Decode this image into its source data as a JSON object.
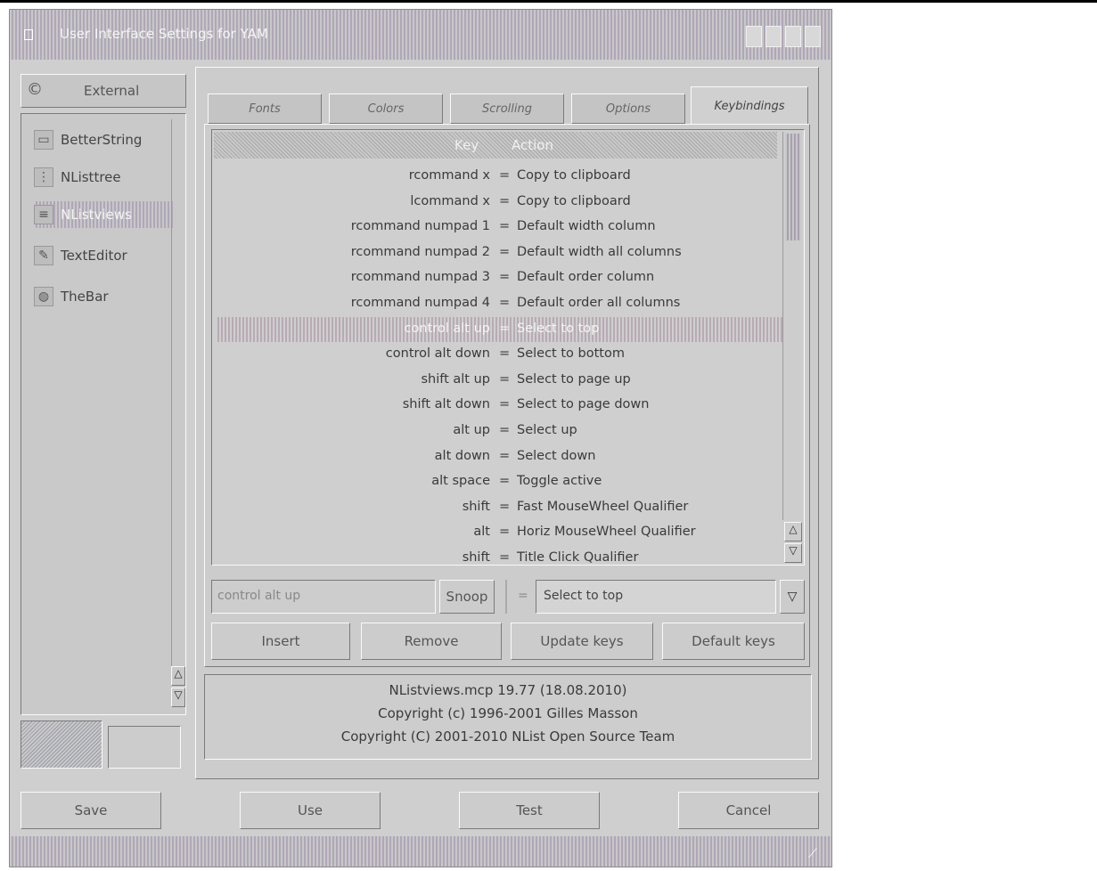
{
  "window": {
    "title": "User Interface Settings for YAM"
  },
  "sidebar": {
    "header_label": "External",
    "items": [
      {
        "label": "BetterString",
        "icon": "string-icon"
      },
      {
        "label": "NListtree",
        "icon": "tree-icon"
      },
      {
        "label": "NListviews",
        "icon": "list-icon"
      },
      {
        "label": "TextEditor",
        "icon": "pen-icon"
      },
      {
        "label": "TheBar",
        "icon": "bar-icon"
      }
    ]
  },
  "tabs": [
    {
      "label": "Fonts"
    },
    {
      "label": "Colors"
    },
    {
      "label": "Scrolling"
    },
    {
      "label": "Options"
    },
    {
      "label": "Keybindings"
    }
  ],
  "keylist": {
    "columns": {
      "key": "Key",
      "action": "Action"
    },
    "rows": [
      {
        "key": "rcommand x",
        "action": "Copy to clipboard"
      },
      {
        "key": "lcommand x",
        "action": "Copy to clipboard"
      },
      {
        "key": "rcommand numpad 1",
        "action": "Default width column"
      },
      {
        "key": "rcommand numpad 2",
        "action": "Default width all columns"
      },
      {
        "key": "rcommand numpad 3",
        "action": "Default order column"
      },
      {
        "key": "rcommand numpad 4",
        "action": "Default order all columns"
      },
      {
        "key": "control alt up",
        "action": "Select to top"
      },
      {
        "key": "control alt down",
        "action": "Select to bottom"
      },
      {
        "key": "shift alt up",
        "action": "Select to page up"
      },
      {
        "key": "shift alt down",
        "action": "Select to page down"
      },
      {
        "key": "alt up",
        "action": "Select up"
      },
      {
        "key": "alt down",
        "action": "Select down"
      },
      {
        "key": "alt space",
        "action": "Toggle active"
      },
      {
        "key": "shift",
        "action": "Fast MouseWheel Qualifier"
      },
      {
        "key": "alt",
        "action": "Horiz MouseWheel Qualifier"
      },
      {
        "key": "shift",
        "action": "Title Click Qualifier"
      }
    ],
    "selected_index": 6
  },
  "editor": {
    "key_value": "control alt up",
    "snoop_label": "Snoop",
    "eq": "=",
    "action_value": "Select to top"
  },
  "actions": {
    "insert": "Insert",
    "remove": "Remove",
    "update": "Update keys",
    "default": "Default keys"
  },
  "info": {
    "line1": "NListviews.mcp 19.77 (18.08.2010)",
    "line2": "Copyright (c) 1996-2001 Gilles Masson",
    "line3": "Copyright (C) 2001-2010 NList Open Source Team"
  },
  "footer": {
    "save": "Save",
    "use": "Use",
    "test": "Test",
    "cancel": "Cancel"
  },
  "colors": {
    "selected_row": "#b8aab4",
    "title_stripe": "#b0a6b8"
  }
}
